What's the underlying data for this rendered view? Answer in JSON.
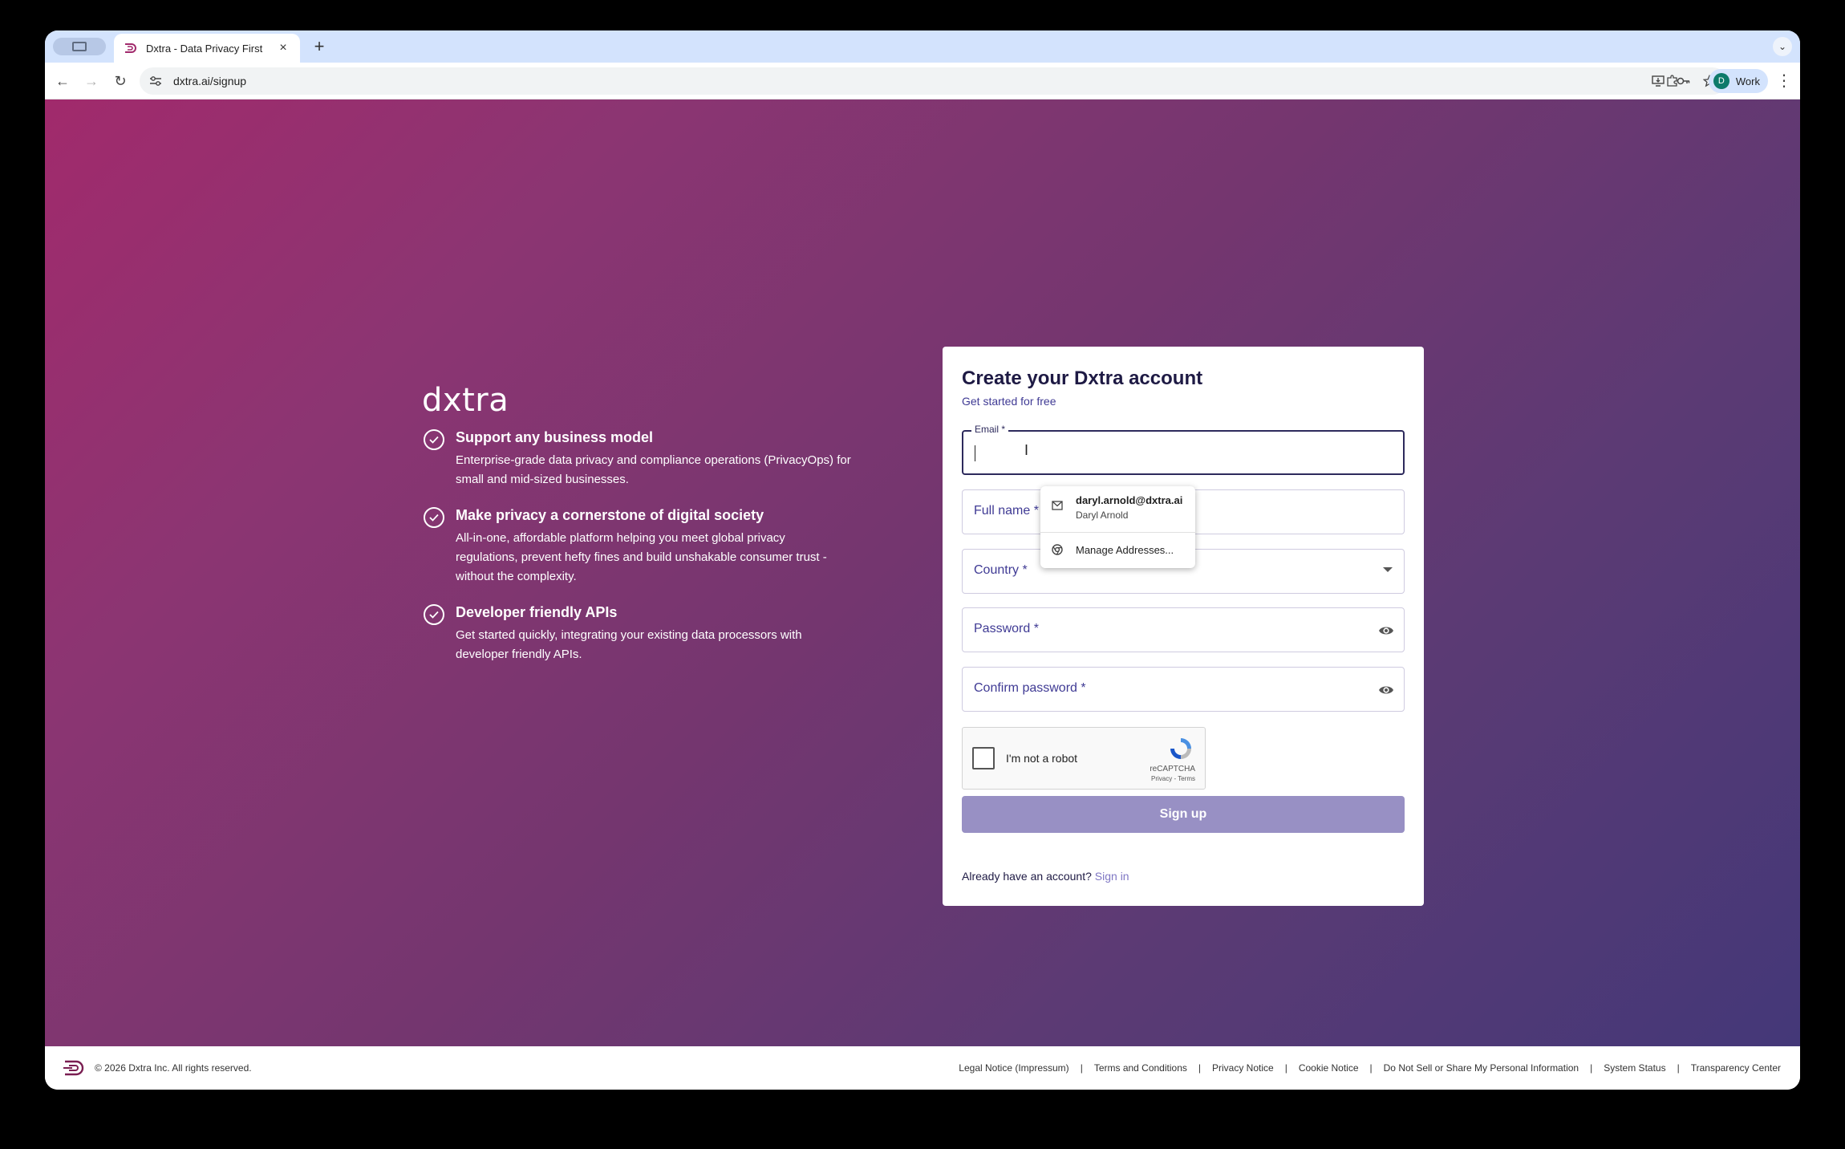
{
  "browser": {
    "tab_title": "Dxtra - Data Privacy First",
    "tab_close": "×",
    "new_tab": "+",
    "url": "dxtra.ai/signup",
    "profile_initial": "D",
    "profile_name": "Work",
    "nav_back": "←",
    "nav_forward": "→",
    "nav_reload": "↻",
    "tab_list": "⌄",
    "menu": "⋮",
    "omni_icons": [
      "install-app-icon",
      "password-key-icon",
      "bookmark-star-icon"
    ]
  },
  "hero": {
    "logo": "dxtra",
    "features": [
      {
        "title": "Support any business model",
        "desc_lines": [
          "Enterprise-grade data privacy and compliance operations (PrivacyOps) for",
          "small and mid-sized businesses."
        ]
      },
      {
        "title": "Make privacy a cornerstone of digital society",
        "desc_lines": [
          "All-in-one, affordable platform helping you meet global privacy",
          "regulations, prevent hefty fines and build unshakable consumer trust -",
          "without the complexity."
        ]
      },
      {
        "title": "Developer friendly APIs",
        "desc_lines": [
          "Get started quickly, integrating your existing data processors with",
          "developer friendly APIs."
        ]
      }
    ]
  },
  "form": {
    "title": "Create your Dxtra account",
    "subtitle": "Get started for free",
    "email_label": "Email *",
    "fullname_label": "Full name *",
    "country_label": "Country *",
    "password_label": "Password *",
    "confirm_label": "Confirm password *",
    "recaptcha_label": "I'm not a robot",
    "recaptcha_brand": "reCAPTCHA",
    "recaptcha_links": "Privacy - Terms",
    "signup_label": "Sign up",
    "already_text": "Already have an account?",
    "signin_label": "Sign in"
  },
  "autofill": {
    "email": "daryl.arnold@dxtra.ai",
    "name": "Daryl Arnold",
    "manage": "Manage Addresses..."
  },
  "footer": {
    "copyright": "© 2026 Dxtra Inc. All rights reserved.",
    "links": [
      "Legal Notice (Impressum)",
      "Terms and Conditions",
      "Privacy Notice",
      "Cookie Notice",
      "Do Not Sell or Share My Personal Information",
      "System Status",
      "Transparency Center"
    ]
  },
  "colors": {
    "brand_dark": "#1e1a44",
    "brand_accent": "#3f3a94",
    "signup_button": "#9890c4",
    "gradient_start": "#a12a6c",
    "gradient_end": "#443878"
  }
}
